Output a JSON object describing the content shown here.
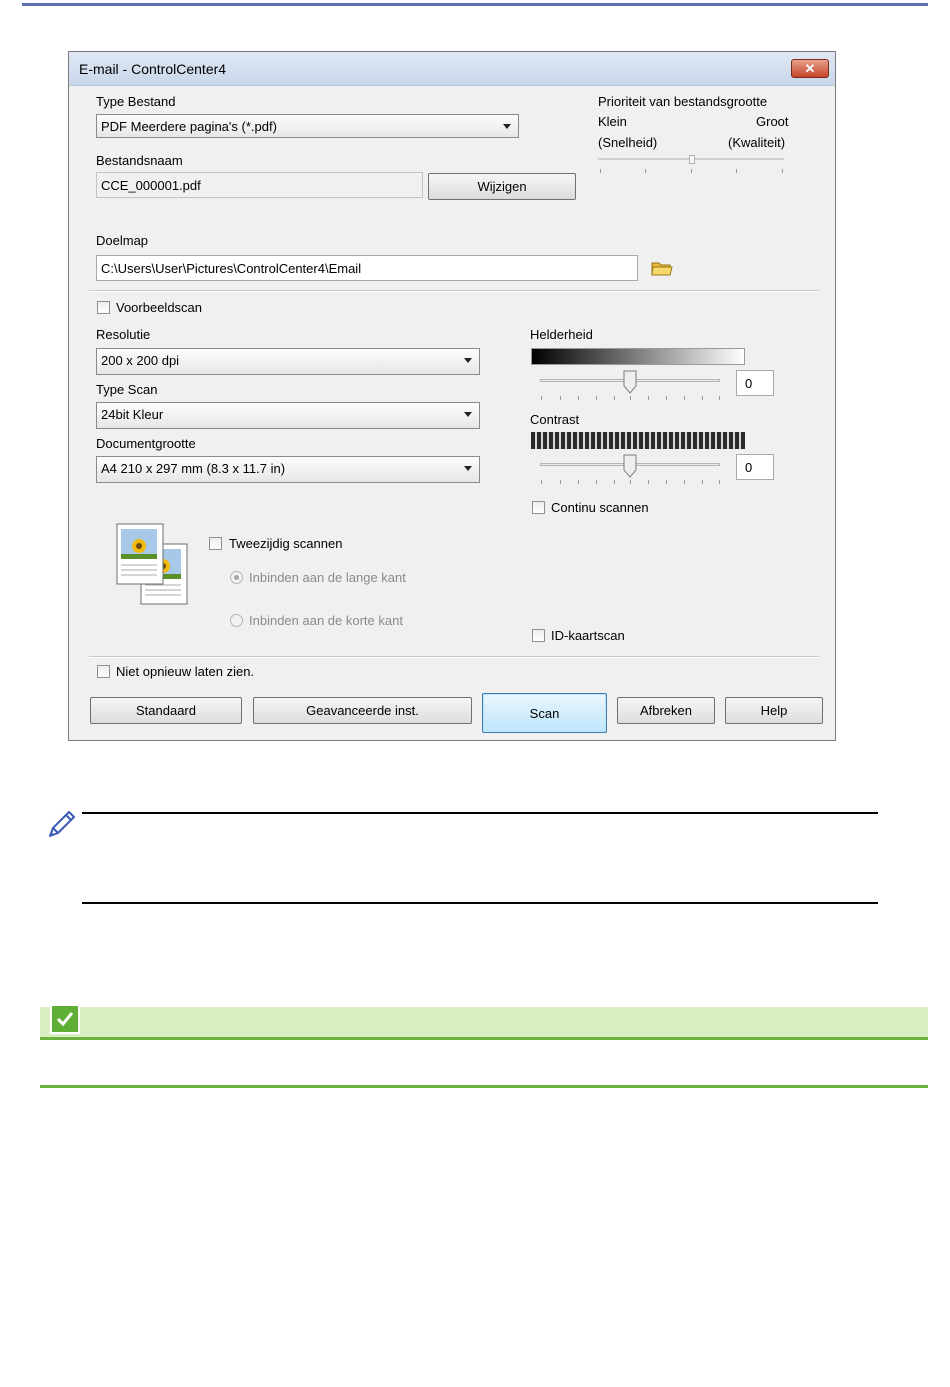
{
  "window": {
    "title": "E-mail - ControlCenter4",
    "close_glyph": "✕"
  },
  "file_type": {
    "label": "Type Bestand",
    "value": "PDF Meerdere pagina's (*.pdf)"
  },
  "file_size_priority": {
    "label": "Prioriteit van bestandsgrootte",
    "small": "Klein",
    "large": "Groot",
    "small_sub": "(Snelheid)",
    "large_sub": "(Kwaliteit)"
  },
  "file_name": {
    "label": "Bestandsnaam",
    "value": "CCE_000001.pdf",
    "change_button": "Wijzigen"
  },
  "destination": {
    "label": "Doelmap",
    "value": "C:\\Users\\User\\Pictures\\ControlCenter4\\Email"
  },
  "preview_scan": {
    "label": "Voorbeeldscan",
    "checked": false
  },
  "resolution": {
    "label": "Resolutie",
    "value": "200 x 200 dpi"
  },
  "scan_type": {
    "label": "Type Scan",
    "value": "24bit Kleur"
  },
  "document_size": {
    "label": "Documentgrootte",
    "value": "A4 210 x 297 mm (8.3 x 11.7 in)"
  },
  "brightness": {
    "label": "Helderheid",
    "value": "0"
  },
  "contrast": {
    "label": "Contrast",
    "value": "0"
  },
  "continuous_scan": {
    "label": "Continu scannen",
    "checked": false
  },
  "duplex": {
    "label": "Tweezijdig scannen",
    "checked": false,
    "long_edge": "Inbinden aan de lange kant",
    "short_edge": "Inbinden aan de korte kant"
  },
  "id_card_scan": {
    "label": "ID-kaartscan",
    "checked": false
  },
  "dont_show_again": {
    "label": "Niet opnieuw laten zien.",
    "checked": false
  },
  "buttons": {
    "default": "Standaard",
    "advanced": "Geavanceerde inst.",
    "scan": "Scan",
    "cancel": "Afbreken",
    "help": "Help"
  },
  "colors": {
    "accent_bar": "#5d6fb4",
    "related_bar": "#d9efc2",
    "related_line": "#6ab43d"
  }
}
